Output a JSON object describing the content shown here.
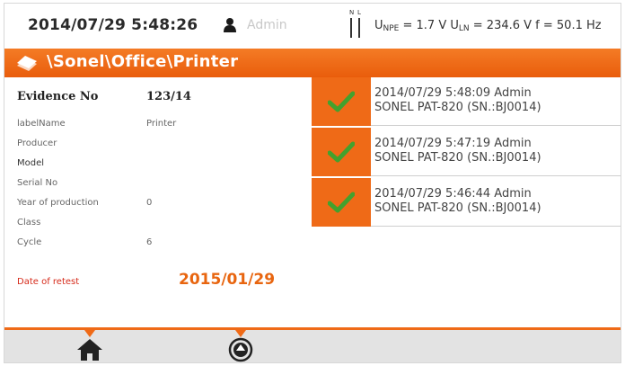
{
  "status_bar": {
    "datetime": "2014/07/29 5:48:26",
    "user": "Admin",
    "nl_labels": [
      "N",
      "L"
    ],
    "measurement_prefix": "U",
    "unpe_sub": "NPE",
    "unpe_value": " = 1.7 V ",
    "uln_prefix": "U",
    "uln_sub": "LN",
    "uln_value": " = 234.6 V ",
    "freq": "f = 50.1 Hz"
  },
  "path_bar": {
    "path": "\\Sonel\\Office\\Printer"
  },
  "details": {
    "evidence_label": "Evidence No",
    "evidence_value": "123/14",
    "labelname_label": "labelName",
    "labelname_value": "Printer",
    "producer_label": "Producer",
    "model_label": "Model",
    "serial_label": "Serial No",
    "year_label": "Year of production",
    "year_value": "0",
    "class_label": "Class",
    "cycle_label": "Cycle",
    "cycle_value": "6",
    "retest_label": "Date of retest",
    "retest_value": "2015/01/29"
  },
  "measurements": [
    {
      "line1": "2014/07/29 5:48:09  Admin",
      "line2": "SONEL PAT-820 (SN.:BJ0014)"
    },
    {
      "line1": "2014/07/29 5:47:19  Admin",
      "line2": "SONEL PAT-820 (SN.:BJ0014)"
    },
    {
      "line1": "2014/07/29 5:46:44  Admin",
      "line2": "SONEL PAT-820 (SN.:BJ0014)"
    }
  ],
  "bottom_bar": {
    "buttons": [
      "home-icon",
      "up-arrow-circle-icon"
    ]
  },
  "colors": {
    "accent": "#ef6a17",
    "retest_label": "#d62a1a",
    "retest_value": "#e8650f",
    "check": "#43a12e"
  }
}
